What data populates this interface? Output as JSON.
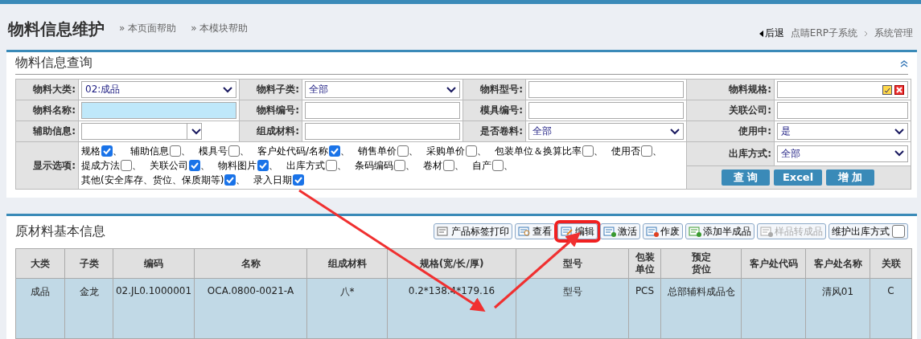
{
  "header": {
    "title": "物料信息维护",
    "help_links": [
      "» 本页面帮助",
      "» 本模块帮助"
    ],
    "back": "后退",
    "breadcrumb": [
      "点睛ERP子系统",
      "系统管理"
    ]
  },
  "query_panel": {
    "title": "物料信息查询",
    "rows": [
      [
        {
          "label": "物料大类:",
          "kind": "select",
          "value": "02:成品"
        },
        {
          "label": "物料子类:",
          "kind": "select",
          "value": "全部"
        },
        {
          "label": "物料型号:",
          "kind": "text"
        },
        {
          "label": "物料规格:",
          "kind": "picker"
        }
      ],
      [
        {
          "label": "物料名称:",
          "kind": "text",
          "focused": true
        },
        {
          "label": "物料编号:",
          "kind": "text"
        },
        {
          "label": "模具编号:",
          "kind": "text"
        },
        {
          "label": "关联公司:",
          "kind": "text"
        }
      ],
      [
        {
          "label": "辅助信息:",
          "kind": "combo"
        },
        {
          "label": "组成材料:",
          "kind": "text"
        },
        {
          "label": "是否卷料:",
          "kind": "select",
          "value": "全部"
        },
        {
          "label": "使用中:",
          "kind": "select",
          "value": "是"
        }
      ]
    ],
    "display_options": {
      "label": "显示选项:",
      "separator": "、",
      "options": [
        {
          "label": "规格",
          "checked": true
        },
        {
          "label": "辅助信息",
          "checked": false
        },
        {
          "label": "模具号",
          "checked": false
        },
        {
          "label": "客户处代码/名称",
          "checked": true
        },
        {
          "label": "销售单价",
          "checked": false
        },
        {
          "label": "采购单价",
          "checked": false
        },
        {
          "label": "包装单位＆换算比率",
          "checked": false
        },
        {
          "label": "使用否",
          "checked": false
        },
        {
          "label": "提成方法",
          "checked": false
        },
        {
          "label": "关联公司",
          "checked": true
        },
        {
          "label": "物料图片",
          "checked": true
        },
        {
          "label": "出库方式",
          "checked": false
        },
        {
          "label": "条码编码",
          "checked": false
        },
        {
          "label": "卷材",
          "checked": false
        },
        {
          "label": "自产",
          "checked": false
        },
        {
          "label": "其他(安全库存、货位、保质期等)",
          "checked": true
        },
        {
          "label": "录入日期",
          "checked": true
        }
      ]
    },
    "outbound": {
      "label": "出库方式:",
      "value": "全部"
    },
    "buttons": [
      "查 询",
      "Excel",
      "增 加"
    ]
  },
  "list_panel": {
    "title": "原材料基本信息",
    "toolbar": [
      {
        "label": "产品标签打印",
        "kind": "print",
        "highlighted": false,
        "disabled": false
      },
      {
        "label": "查看",
        "kind": "view",
        "highlighted": false,
        "disabled": false
      },
      {
        "label": "编辑",
        "kind": "edit",
        "highlighted": true,
        "disabled": false
      },
      {
        "label": "激活",
        "kind": "activate",
        "highlighted": false,
        "disabled": false
      },
      {
        "label": "作废",
        "kind": "void",
        "highlighted": false,
        "disabled": false
      },
      {
        "label": "添加半成品",
        "kind": "add",
        "highlighted": false,
        "disabled": false
      },
      {
        "label": "样品转成品",
        "kind": "convert",
        "highlighted": false,
        "disabled": true
      },
      {
        "label": "维护出库方式",
        "kind": "checkbox",
        "checked": false,
        "highlighted": false,
        "disabled": false
      }
    ],
    "columns": [
      "大类",
      "子类",
      "编码",
      "名称",
      "组成材料",
      "规格(宽/长/厚)",
      "型号",
      "包装单位",
      "预定货位",
      "客户处代码",
      "客户处名称",
      "关联"
    ],
    "rows": [
      {
        "selected": true,
        "cells": [
          "成品",
          "金龙",
          "02.JL0.1000001",
          "OCA.0800-0021-A",
          "八*",
          "0.2*138.4*179.16",
          "型号",
          "PCS",
          "总部辅料成品仓",
          "",
          "清风01",
          "C"
        ]
      }
    ]
  }
}
